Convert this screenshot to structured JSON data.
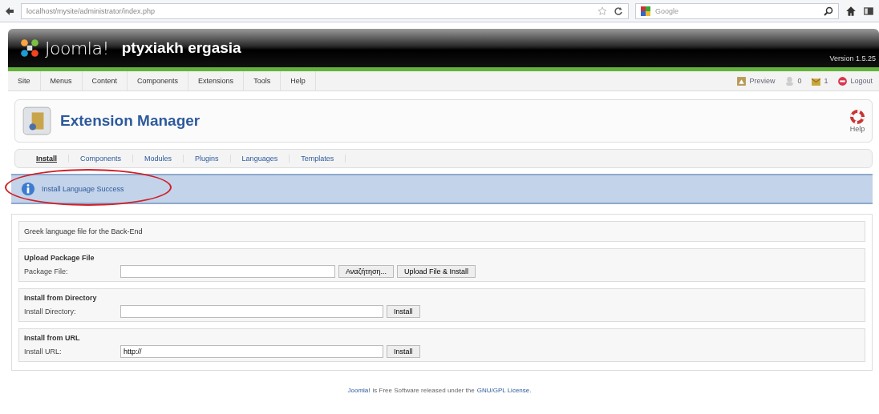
{
  "browser": {
    "address": "localhost/mysite/administrator/index.php",
    "search_placeholder": "Google"
  },
  "header": {
    "logo_text": "Joomla!",
    "site_name": "ptyxiakh ergasia",
    "version": "Version 1.5.25"
  },
  "menu": [
    {
      "label": "Site"
    },
    {
      "label": "Menus"
    },
    {
      "label": "Content"
    },
    {
      "label": "Components"
    },
    {
      "label": "Extensions"
    },
    {
      "label": "Tools"
    },
    {
      "label": "Help"
    }
  ],
  "status": [
    {
      "kind": "preview",
      "label": "Preview"
    },
    {
      "kind": "users",
      "label": "0"
    },
    {
      "kind": "messages",
      "label": "1"
    },
    {
      "kind": "logout",
      "label": "Logout"
    }
  ],
  "toolbar": {
    "title": "Extension Manager",
    "help_label": "Help"
  },
  "submenu": [
    {
      "label": "Install",
      "selected": true
    },
    {
      "label": "Components",
      "selected": false
    },
    {
      "label": "Modules",
      "selected": false
    },
    {
      "label": "Plugins",
      "selected": false
    },
    {
      "label": "Languages",
      "selected": false
    },
    {
      "label": "Templates",
      "selected": false
    }
  ],
  "message": {
    "text": "Install Language Success",
    "circled": true
  },
  "form": {
    "description": "Greek language file for the Back-End",
    "sections": [
      {
        "title": "Upload Package File",
        "label": "Package File:",
        "buttons": [
          "Αναζήτηση...",
          "Upload File & Install"
        ]
      },
      {
        "title": "Install from Directory",
        "label": "Install Directory:",
        "buttons": [
          "Install"
        ]
      },
      {
        "title": "Install from URL",
        "label": "Install URL:",
        "value": "http://",
        "buttons": [
          "Install"
        ]
      }
    ]
  },
  "footer": [
    {
      "kind": "link",
      "text": "Joomla!"
    },
    {
      "kind": "text",
      "text": "is Free Software released under the"
    },
    {
      "kind": "link",
      "text": "GNU/GPL License."
    }
  ]
}
